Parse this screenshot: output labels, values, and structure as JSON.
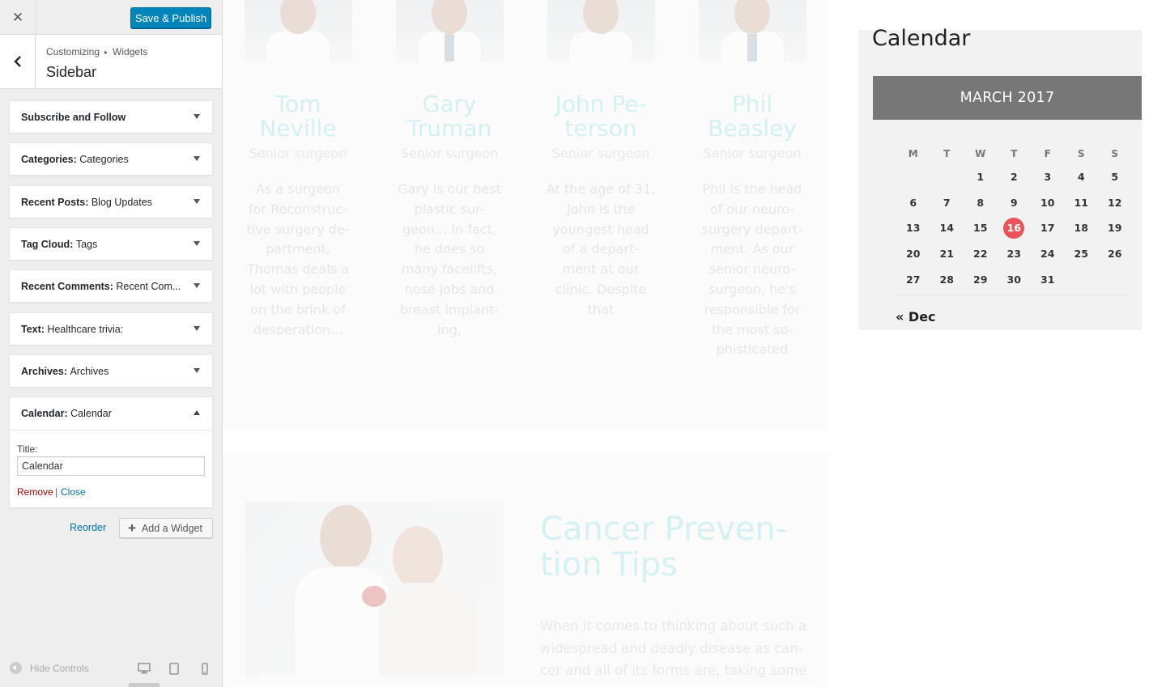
{
  "customizer": {
    "close_icon": "close-icon",
    "publish_label": "Save & Publish",
    "breadcrumb": {
      "part1": "Customizing",
      "separator": "▸",
      "part2": "Widgets"
    },
    "section_title": "Sidebar",
    "widgets": [
      {
        "name": "Subscribe and Follow",
        "sub": ""
      },
      {
        "name": "Categories",
        "sub": "Categories"
      },
      {
        "name": "Recent Posts",
        "sub": "Blog Updates"
      },
      {
        "name": "Tag Cloud",
        "sub": "Tags"
      },
      {
        "name": "Recent Comments",
        "sub": "Recent Com..."
      },
      {
        "name": "Text",
        "sub": "Healthcare trivia:"
      },
      {
        "name": "Archives",
        "sub": "Archives"
      },
      {
        "name": "Calendar",
        "sub": "Calendar"
      }
    ],
    "calendar_form": {
      "title_label": "Title:",
      "title_value": "Calendar",
      "remove": "Remove",
      "pipe": "|",
      "close": "Close"
    },
    "reorder": "Reorder",
    "add_widget": "Add a Widget",
    "hide_controls": "Hide Controls"
  },
  "preview": {
    "doctors": [
      {
        "name": "Tom\nNeville",
        "role": "Senior surgeon",
        "bio": "As a surgeon\nfor Reconstruc-\ntive surgery de-\npartment,\nThomas deals a\nlot with people\non the brink of\ndesperation..."
      },
      {
        "name": "Gary\nTruman",
        "role": "Senior surgeon",
        "bio": "Gary is our best\nplastic sur-\ngeon... In fact,\nhe does so\nmany facelifts,\nnose jobs and\nbreast implant-\ning,"
      },
      {
        "name": "John Pe-\nterson",
        "role": "Senior surgeon",
        "bio": "At the age of 31,\nJohn is the\nyoungest head\nof a depart-\nment at our\nclinic. Despite\nthat"
      },
      {
        "name": "Phil\nBeasley",
        "role": "Senior surgeon",
        "bio": "Phil is the head\nof our neuro-\nsurgery depart-\nment. As our\nsenior neuro-\nsurgeon, he's\nresponsible for\nthe most so-\nphisticated"
      }
    ],
    "cancer": {
      "title": "Cancer Preven-\ntion Tips",
      "body": "When it comes to thinking about such a\nwidespread and deadly disease as can-\ncer and all of its forms are, taking some"
    },
    "calendar": {
      "heading": "Calendar",
      "month": "MARCH 2017",
      "weekdays": [
        "M",
        "T",
        "W",
        "T",
        "F",
        "S",
        "S"
      ],
      "weeks": [
        [
          "",
          "",
          "1",
          "2",
          "3",
          "4",
          "5"
        ],
        [
          "6",
          "7",
          "8",
          "9",
          "10",
          "11",
          "12"
        ],
        [
          "13",
          "14",
          "15",
          "16",
          "17",
          "18",
          "19"
        ],
        [
          "20",
          "21",
          "22",
          "23",
          "24",
          "25",
          "26"
        ],
        [
          "27",
          "28",
          "29",
          "30",
          "31",
          "",
          ""
        ]
      ],
      "today": "16",
      "prev_link": "« Dec"
    }
  },
  "colors": {
    "publish": "#0085ba",
    "today": "#e9555a",
    "month_header": "#777777",
    "link": "#0073aa",
    "remove": "#aa0000"
  }
}
